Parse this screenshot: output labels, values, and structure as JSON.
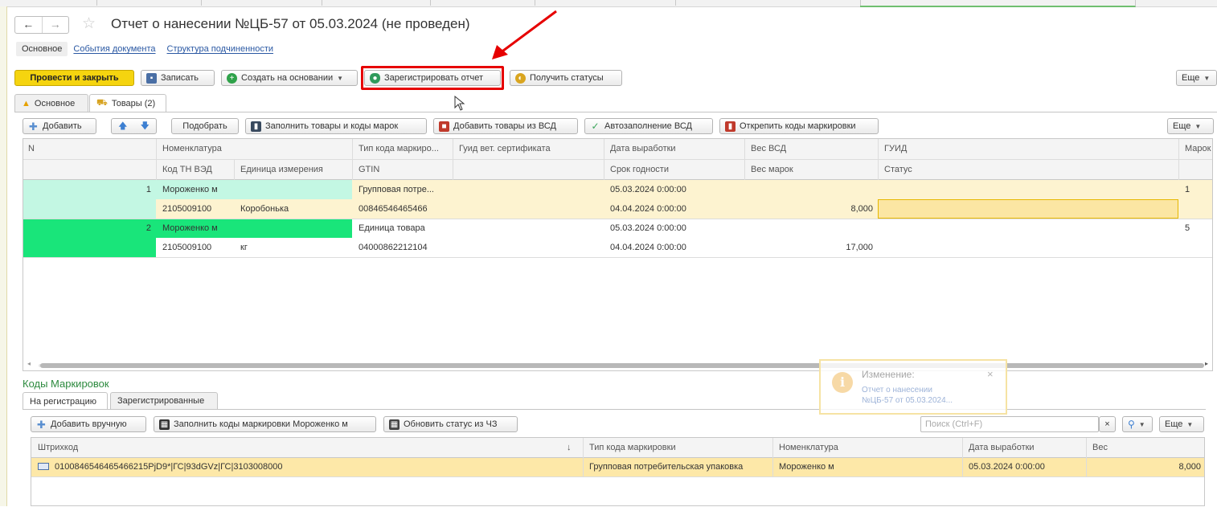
{
  "window": {
    "title": "Отчет о нанесении №ЦБ-57 от 05.03.2024 (не проведен)",
    "nav_back": "←",
    "nav_forward": "→",
    "favorite_icon": "star-icon"
  },
  "sublinks": [
    "Основное",
    "События документа",
    "Структура подчиненности"
  ],
  "toolbar": {
    "post_close": "Провести и закрыть",
    "save": "Записать",
    "create_based": "Создать на основании",
    "register_report": "Зарегистрировать отчет",
    "get_statuses": "Получить статусы",
    "more": "Еще"
  },
  "tabs": {
    "main": "Основное",
    "goods": "Товары (2)"
  },
  "goods_toolbar": {
    "add": "Добавить",
    "pick": "Подобрать",
    "fill_goods_codes": "Заполнить товары и коды марок",
    "add_goods_vsd": "Добавить товары из ВСД",
    "autofill_vsd": "Автозаполнение ВСД",
    "unpin_codes": "Открепить коды маркировки",
    "more": "Еще"
  },
  "goods_table": {
    "headers_row1": [
      "N",
      "Номенклатура",
      "Тип кода маркиро...",
      "Гуид вет. сертификата",
      "Дата выработки",
      "Вес ВСД",
      "ГУИД",
      "Марок"
    ],
    "headers_row2": [
      "Код ТН ВЭД",
      "Единица измерения",
      "GTIN",
      "Срок годности",
      "Вес марок",
      "Статус"
    ],
    "rows": [
      {
        "n": "1",
        "nomenclature": "Мороженко м",
        "code_type": "Групповая потре...",
        "prod_date": "05.03.2024 0:00:00",
        "marks": "1",
        "tnved": "2105009100",
        "unit": "Коробонька",
        "gtin": "00846546465466",
        "expiry": "04.04.2024 0:00:00",
        "weight_marks": "8,000"
      },
      {
        "n": "2",
        "nomenclature": "Мороженко м",
        "code_type": "Единица товара",
        "prod_date": "05.03.2024 0:00:00",
        "marks": "5",
        "tnved": "2105009100",
        "unit": "кг",
        "gtin": "04000862212104",
        "expiry": "04.04.2024 0:00:00",
        "weight_marks": "17,000"
      }
    ]
  },
  "codes_section": {
    "title": "Коды Маркировок",
    "tab_pending": "На регистрацию",
    "tab_registered": "Зарегистрированные",
    "add_manual": "Добавить вручную",
    "fill_codes": "Заполнить коды маркировки Мороженко м",
    "update_status": "Обновить статус из ЧЗ",
    "search_placeholder": "Поиск (Ctrl+F)",
    "clear": "×",
    "more": "Еще",
    "headers": [
      "Штрихкод",
      "↓",
      "Тип кода маркировки",
      "Номенклатура",
      "Дата выработки",
      "Вес"
    ],
    "rows": [
      {
        "barcode": "0100846546465466215PjD9*|ГС|93dGVz|ГС|3103008000",
        "code_type": "Групповая потребительская упаковка",
        "nomenclature": "Мороженко м",
        "prod_date": "05.03.2024 0:00:00",
        "weight": "8,000"
      }
    ]
  },
  "notification": {
    "title": "Изменение:",
    "line1": "Отчет о нанесении",
    "line2": "№ЦБ-57 от 05.03.2024...",
    "close": "×"
  },
  "colors": {
    "accent_yellow": "#f5d40f",
    "highlight_red": "#e60000",
    "row_yellow": "#fdf3d0",
    "row_green_light": "#c3f7e3",
    "row_green_bright": "#19e57a",
    "section_green": "#2c8a3e"
  }
}
